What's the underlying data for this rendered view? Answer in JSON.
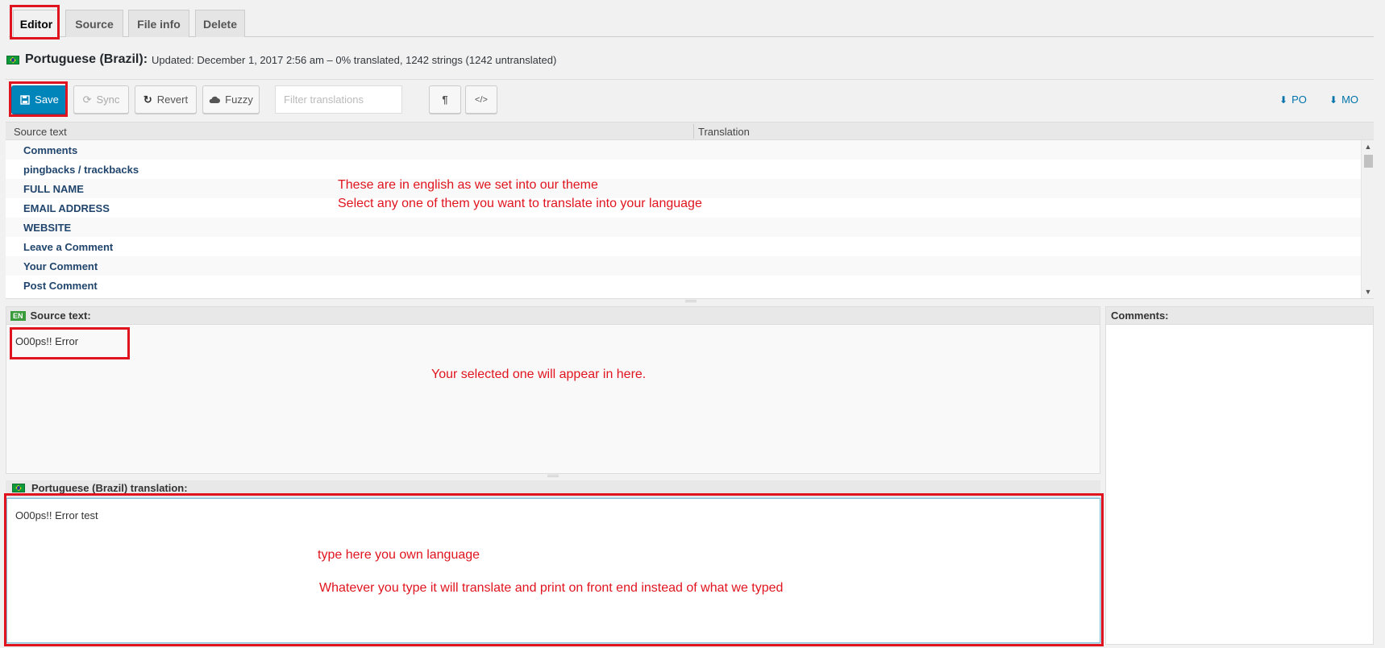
{
  "tabs": [
    {
      "label": "Editor",
      "active": true
    },
    {
      "label": "Source"
    },
    {
      "label": "File info"
    },
    {
      "label": "Delete"
    }
  ],
  "locale": {
    "name": "Portuguese (Brazil):",
    "meta": "Updated: December 1, 2017 2:56 am – 0% translated, 1242 strings (1242 untranslated)"
  },
  "toolbar": {
    "save_label": "Save",
    "sync_label": "Sync",
    "revert_label": "Revert",
    "fuzzy_label": "Fuzzy",
    "filter_placeholder": "Filter translations",
    "para_label": "¶",
    "code_label": "</>",
    "po_label": "PO",
    "mo_label": "MO"
  },
  "grid": {
    "col_source": "Source text",
    "col_translation": "Translation",
    "rows": [
      "Comments",
      "pingbacks / trackbacks",
      "FULL NAME",
      "EMAIL ADDRESS",
      "WEBSITE",
      "Leave a Comment",
      "Your Comment",
      "Post Comment"
    ]
  },
  "source_pane": {
    "lang_code": "EN",
    "label": "Source text:",
    "value": "O00ps!! Error"
  },
  "comments_pane": {
    "label": "Comments:"
  },
  "translation_pane": {
    "label": "Portuguese (Brazil) translation:",
    "value": "O00ps!! Error test"
  },
  "annotations": {
    "list_line1": "These are in english as we set into our theme",
    "list_line2": "Select any one of them you want to translate into your language",
    "source_note": "Your selected one will appear in here.",
    "trans_line1": "type here you own language",
    "trans_line2": "Whatever you type it will translate and print on front end instead of what we typed"
  },
  "colors": {
    "accent": "#0085ba",
    "annotation": "#e0141e",
    "link": "#0073aa"
  },
  "icons": {
    "save": "floppy-icon",
    "sync": "refresh-icon",
    "revert": "undo-icon",
    "fuzzy": "cloud-icon",
    "download": "download-icon"
  }
}
